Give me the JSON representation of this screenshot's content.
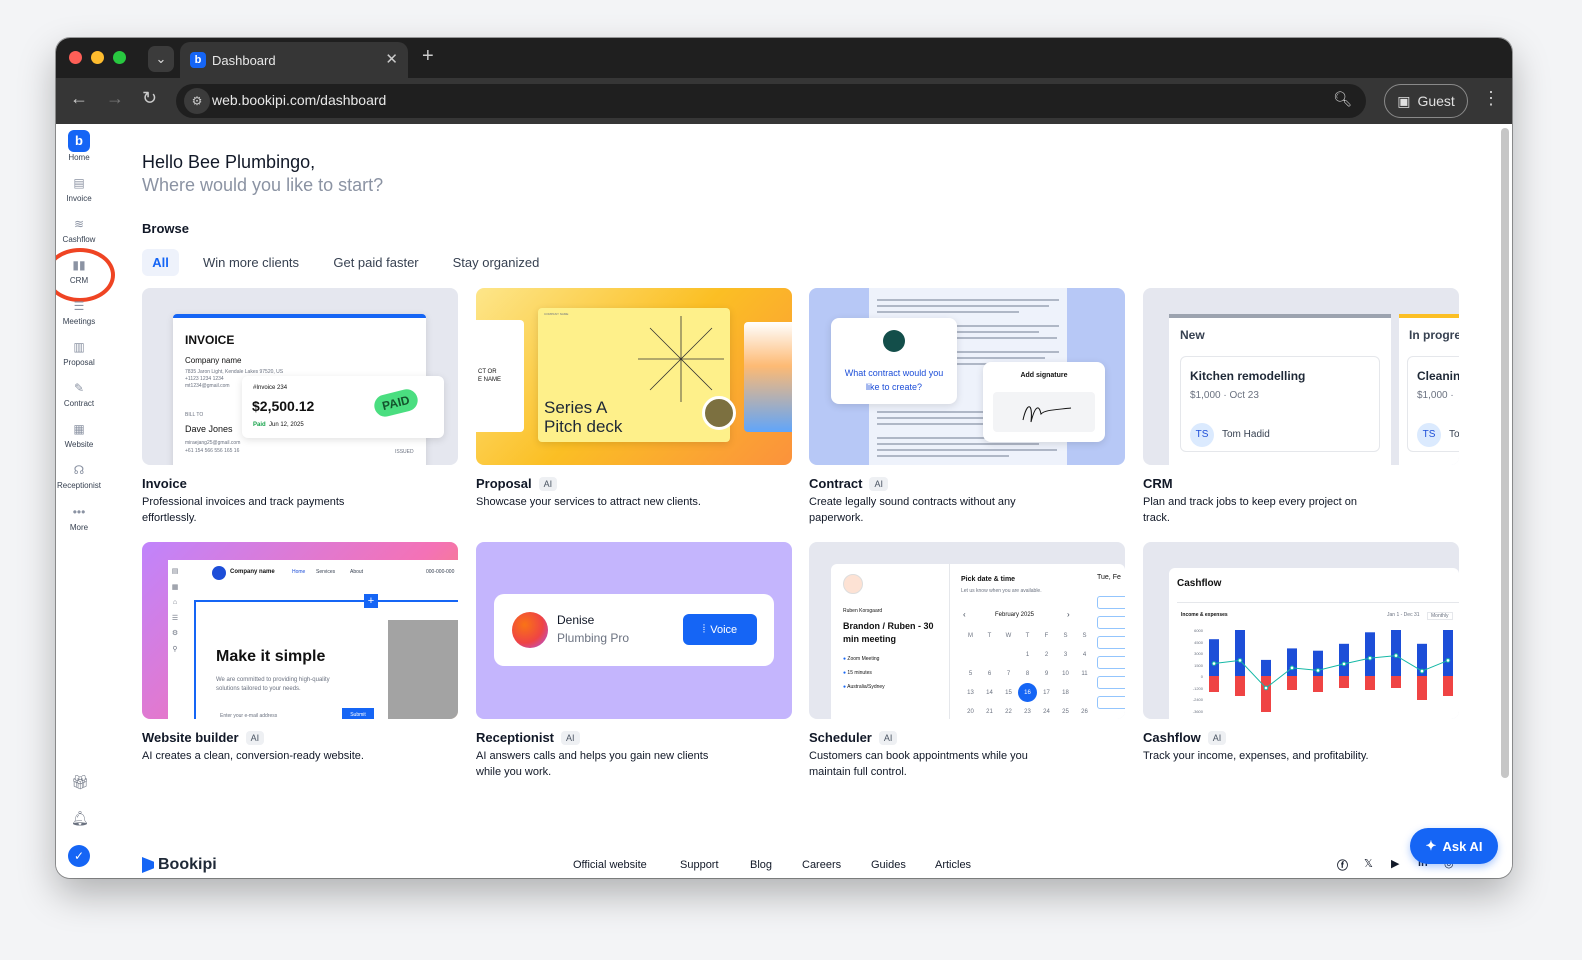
{
  "browser": {
    "tab_title": "Dashboard",
    "url": "web.bookipi.com/dashboard",
    "profile": "Guest",
    "icons": [
      "chevron-down-icon",
      "close-icon",
      "plus-icon",
      "back-icon",
      "forward-icon",
      "reload-icon",
      "tune-icon",
      "zoom-icon",
      "profile-icon",
      "kebab-icon"
    ]
  },
  "sidebar": {
    "items": [
      {
        "label": "Home",
        "icon": "home-icon"
      },
      {
        "label": "Invoice",
        "icon": "invoice-icon"
      },
      {
        "label": "Cashflow",
        "icon": "cashflow-icon"
      },
      {
        "label": "CRM",
        "icon": "crm-icon"
      },
      {
        "label": "Meetings",
        "icon": "meetings-icon"
      },
      {
        "label": "Proposal",
        "icon": "proposal-icon"
      },
      {
        "label": "Contract",
        "icon": "contract-icon"
      },
      {
        "label": "Website",
        "icon": "website-icon"
      },
      {
        "label": "Receptionist",
        "icon": "headset-icon"
      },
      {
        "label": "More",
        "icon": "more-icon"
      }
    ],
    "bottom_icons": [
      "gift-icon",
      "bell-icon",
      "profile-check-icon"
    ]
  },
  "greeting": {
    "hello": "Hello Bee Plumbingo,",
    "prompt": "Where would you like to start?"
  },
  "browse": {
    "label": "Browse",
    "chips": [
      "All",
      "Win more clients",
      "Get paid faster",
      "Stay organized"
    ],
    "selected": "All"
  },
  "cards": [
    {
      "title": "Invoice",
      "ai": false,
      "desc": "Professional invoices and track payments effortlessly."
    },
    {
      "title": "Proposal",
      "ai": true,
      "desc": "Showcase your services to attract new clients."
    },
    {
      "title": "Contract",
      "ai": true,
      "desc": "Create legally sound contracts without any paperwork."
    },
    {
      "title": "CRM",
      "ai": false,
      "desc": "Plan and track jobs to keep every project on track."
    },
    {
      "title": "Website builder",
      "ai": true,
      "desc": "AI creates a clean, conversion-ready website."
    },
    {
      "title": "Receptionist",
      "ai": true,
      "desc": "AI answers calls and helps you gain new clients while you work."
    },
    {
      "title": "Scheduler",
      "ai": true,
      "desc": "Customers can book appointments while you maintain full control."
    },
    {
      "title": "Cashflow",
      "ai": true,
      "desc": "Track your income, expenses, and profitability."
    }
  ],
  "ai_badge": "AI",
  "previews": {
    "invoice": {
      "heading": "INVOICE",
      "company": "Company name",
      "address_1": "7835 Jaron Light, Kendale Lakes 97520, US",
      "address_2": "+1123 1234 1234",
      "address_3": "mt1234@gmail.com",
      "number": "#Invoice 234",
      "amount": "$2,500.12",
      "paid_label": "Paid",
      "paid_date": "Jun 12, 2025",
      "stamp": "PAID",
      "bill_to": "BILL TO",
      "client": "Dave Jones",
      "email": "miraejang25@gmail.com",
      "phone": "+61 154 566 556 165 16",
      "issued": "ISSUED"
    },
    "proposal": {
      "left_text": "CT OR\nE NAME",
      "title": "Series A\nPitch deck",
      "small": "COMPANY NAME"
    },
    "contract": {
      "question": "What contract would you like to create?",
      "sign": "Add signature"
    },
    "crm": {
      "col1": "New",
      "col2": "In progre",
      "job1": "Kitchen remodelling",
      "job1_meta": "$1,000 · Oct 23",
      "job1_initials": "TS",
      "job1_person": "Tom Hadid",
      "job2": "Cleanin",
      "job2_meta": "$1,000 ·",
      "job2_initials": "TS",
      "job2_person": "To"
    },
    "website": {
      "company": "Company name",
      "nav": [
        "Home",
        "Services",
        "About"
      ],
      "phone": "000-000-000",
      "headline": "Make it simple",
      "sub": "We are committed to providing high-quality solutions tailored to your needs.",
      "placeholder": "Enter your e-mail address",
      "submit": "Submit"
    },
    "receptionist": {
      "name": "Denise",
      "company": "Plumbing Pro",
      "button": "Voice"
    },
    "scheduler": {
      "host": "Ruben Korsgaard",
      "meeting": "Brandon / Ruben - 30 min meeting",
      "place": "Zoom Meeting",
      "duration": "15 minutes",
      "tz": "Australia/Sydney",
      "pick": "Pick date & time",
      "pick_sub": "Let us know when you are available.",
      "month": "February 2025",
      "days": [
        "M",
        "T",
        "W",
        "T",
        "F",
        "S",
        "S"
      ],
      "dates": [
        [
          "",
          "",
          "",
          "1",
          "2",
          "3",
          "4"
        ],
        [
          "5",
          "6",
          "7",
          "8",
          "9",
          "10",
          "11"
        ],
        [
          "13",
          "14",
          "15",
          "16",
          "17",
          "18",
          ""
        ],
        [
          "20",
          "21",
          "22",
          "23",
          "24",
          "25",
          "26"
        ]
      ],
      "selected": "16",
      "right": "Tue, Fe"
    },
    "cashflow": {
      "title": "Cashflow",
      "subtitle": "Income & expenses",
      "range": "Jan 1 - Dec 31",
      "period": "Monthly",
      "yticks": [
        "6000",
        "4500",
        "3000",
        "1500",
        "0",
        "-1200",
        "-2400",
        "-3600"
      ]
    }
  },
  "footer": {
    "brand": "Bookipi",
    "links": [
      "Official website",
      "Support",
      "Blog",
      "Careers",
      "Guides",
      "Articles"
    ],
    "social_icons": [
      "facebook-icon",
      "x-icon",
      "youtube-icon",
      "linkedin-icon",
      "instagram-icon"
    ]
  },
  "ask_ai": "Ask AI",
  "colors": {
    "accent": "#1565f5",
    "annotation_ring": "#ef4423",
    "paid": "#4ade80",
    "bar_income": "#1d4ed8",
    "bar_expense": "#ef4444",
    "net_line": "#14b8a6"
  }
}
